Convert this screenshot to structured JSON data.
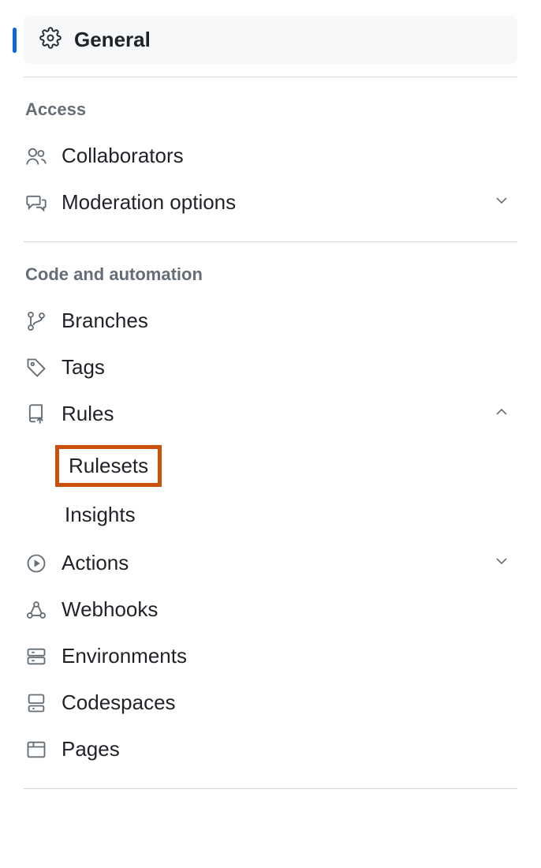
{
  "sidebar": {
    "active": {
      "label": "General"
    },
    "sections": [
      {
        "title": "Access",
        "items": [
          {
            "label": "Collaborators"
          },
          {
            "label": "Moderation options",
            "expandable": true,
            "expanded": false
          }
        ]
      },
      {
        "title": "Code and automation",
        "items": [
          {
            "label": "Branches"
          },
          {
            "label": "Tags"
          },
          {
            "label": "Rules",
            "expandable": true,
            "expanded": true,
            "children": [
              {
                "label": "Rulesets",
                "highlighted": true
              },
              {
                "label": "Insights"
              }
            ]
          },
          {
            "label": "Actions",
            "expandable": true,
            "expanded": false
          },
          {
            "label": "Webhooks"
          },
          {
            "label": "Environments"
          },
          {
            "label": "Codespaces"
          },
          {
            "label": "Pages"
          }
        ]
      }
    ]
  }
}
